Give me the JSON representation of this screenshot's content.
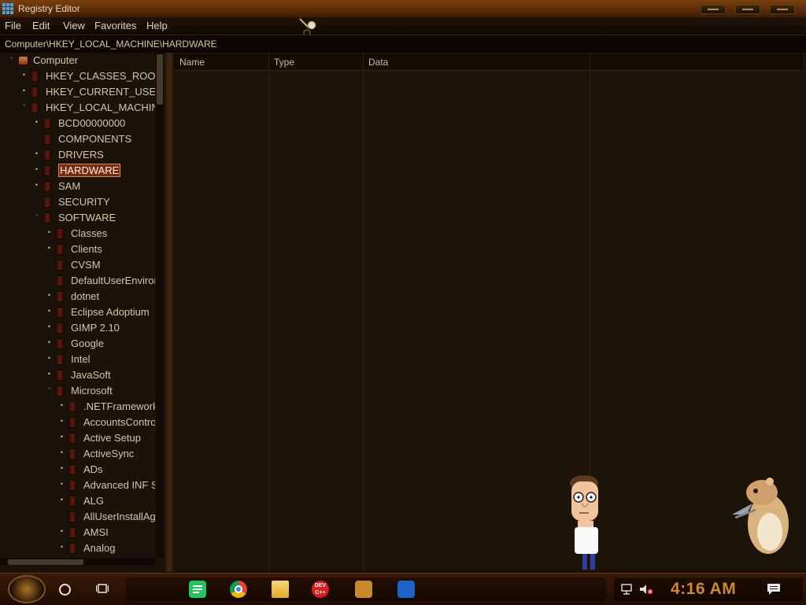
{
  "window": {
    "title": "Registry Editor",
    "controls": {
      "minimize": "",
      "maximize": "",
      "close": ""
    }
  },
  "menu": [
    "File",
    "Edit",
    "View",
    "Favorites",
    "Help"
  ],
  "address": "Computer\\HKEY_LOCAL_MACHINE\\HARDWARE",
  "tree": [
    {
      "label": "Computer",
      "level": 0,
      "state": "open",
      "icon": "computer-icon"
    },
    {
      "label": "HKEY_CLASSES_ROOT",
      "level": 1,
      "state": "closed"
    },
    {
      "label": "HKEY_CURRENT_USER",
      "level": 1,
      "state": "closed"
    },
    {
      "label": "HKEY_LOCAL_MACHINE",
      "level": 1,
      "state": "open"
    },
    {
      "label": "BCD00000000",
      "level": 2,
      "state": "closed"
    },
    {
      "label": "COMPONENTS",
      "level": 2,
      "state": "none"
    },
    {
      "label": "DRIVERS",
      "level": 2,
      "state": "closed"
    },
    {
      "label": "HARDWARE",
      "level": 2,
      "state": "closed",
      "selected": true
    },
    {
      "label": "SAM",
      "level": 2,
      "state": "closed"
    },
    {
      "label": "SECURITY",
      "level": 2,
      "state": "none"
    },
    {
      "label": "SOFTWARE",
      "level": 2,
      "state": "open"
    },
    {
      "label": "Classes",
      "level": 3,
      "state": "closed"
    },
    {
      "label": "Clients",
      "level": 3,
      "state": "closed"
    },
    {
      "label": "CVSM",
      "level": 3,
      "state": "none"
    },
    {
      "label": "DefaultUserEnvironment",
      "level": 3,
      "state": "none"
    },
    {
      "label": "dotnet",
      "level": 3,
      "state": "closed"
    },
    {
      "label": "Eclipse Adoptium",
      "level": 3,
      "state": "closed"
    },
    {
      "label": "GIMP 2.10",
      "level": 3,
      "state": "closed"
    },
    {
      "label": "Google",
      "level": 3,
      "state": "closed"
    },
    {
      "label": "Intel",
      "level": 3,
      "state": "closed"
    },
    {
      "label": "JavaSoft",
      "level": 3,
      "state": "closed"
    },
    {
      "label": "Microsoft",
      "level": 3,
      "state": "open"
    },
    {
      "label": ".NETFramework",
      "level": 4,
      "state": "closed"
    },
    {
      "label": "AccountsControl",
      "level": 4,
      "state": "closed"
    },
    {
      "label": "Active Setup",
      "level": 4,
      "state": "closed"
    },
    {
      "label": "ActiveSync",
      "level": 4,
      "state": "closed"
    },
    {
      "label": "ADs",
      "level": 4,
      "state": "closed"
    },
    {
      "label": "Advanced INF Setup",
      "level": 4,
      "state": "closed"
    },
    {
      "label": "ALG",
      "level": 4,
      "state": "closed"
    },
    {
      "label": "AllUserInstallAgent",
      "level": 4,
      "state": "none"
    },
    {
      "label": "AMSI",
      "level": 4,
      "state": "closed"
    },
    {
      "label": "Analog",
      "level": 4,
      "state": "closed"
    }
  ],
  "columns": [
    "Name",
    "Type",
    "Data"
  ],
  "taskbar": {
    "pinned": [
      {
        "name": "notes-icon",
        "color": "#22c55e"
      },
      {
        "name": "chrome-icon",
        "color": "#e3a21a"
      },
      {
        "name": "file-explorer-icon",
        "color": "#f2c14e"
      },
      {
        "name": "dev-cpp-icon",
        "color": "#d91c1c",
        "text": "DEV C++"
      },
      {
        "name": "game-icon",
        "color": "#c78a2a"
      },
      {
        "name": "virtualbox-icon",
        "color": "#1e64c8"
      }
    ],
    "clock": "4:16 AM"
  }
}
